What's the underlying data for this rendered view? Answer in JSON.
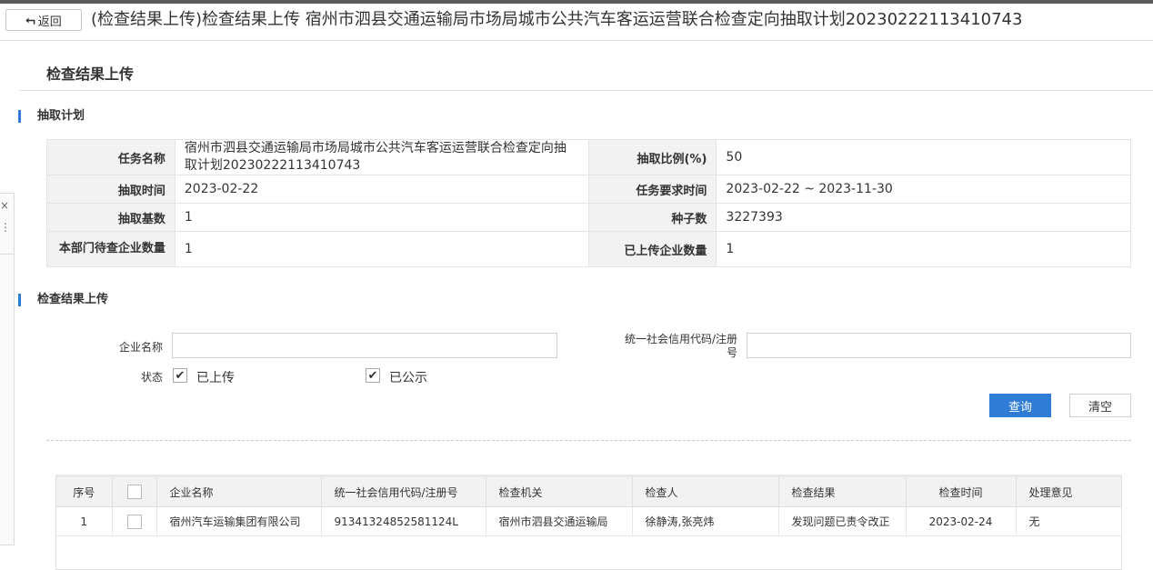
{
  "header": {
    "back_label": "返回",
    "title": "(检查结果上传)检查结果上传 宿州市泗县交通运输局市场局城市公共汽车客运运营联合检查定向抽取计划20230222113410743"
  },
  "side_tab": {
    "close": "×",
    "more": "⋮"
  },
  "section_title": "检查结果上传",
  "plan": {
    "title": "抽取计划",
    "rows": [
      {
        "l1": "任务名称",
        "v1": "宿州市泗县交通运输局市场局城市公共汽车客运运营联合检查定向抽取计划20230222113410743",
        "l2": "抽取比例(%)",
        "v2": "50"
      },
      {
        "l1": "抽取时间",
        "v1": "2023-02-22",
        "l2": "任务要求时间",
        "v2": "2023-02-22 ~ 2023-11-30"
      },
      {
        "l1": "抽取基数",
        "v1": "1",
        "l2": "种子数",
        "v2": "3227393"
      },
      {
        "l1": "本部门待查企业数量",
        "v1": "1",
        "l2": "已上传企业数量",
        "v2": "1"
      }
    ]
  },
  "upload": {
    "title": "检查结果上传",
    "company_label": "企业名称",
    "company_value": "",
    "credit_label": "统一社会信用代码/注册号",
    "credit_value": "",
    "status_label": "状态",
    "status_options": [
      {
        "label": "已上传",
        "checked": true
      },
      {
        "label": "已公示",
        "checked": true
      }
    ],
    "query_label": "查询",
    "clear_label": "清空"
  },
  "results": {
    "columns": [
      "序号",
      "",
      "企业名称",
      "统一社会信用代码/注册号",
      "检查机关",
      "检查人",
      "检查结果",
      "检查时间",
      "处理意见"
    ],
    "rows": [
      [
        "1",
        "",
        "宿州汽车运输集团有限公司",
        "91341324852581124L",
        "宿州市泗县交通运输局",
        "徐静涛,张亮炜",
        "发现问题已责令改正",
        "2023-02-24",
        "无"
      ]
    ]
  }
}
